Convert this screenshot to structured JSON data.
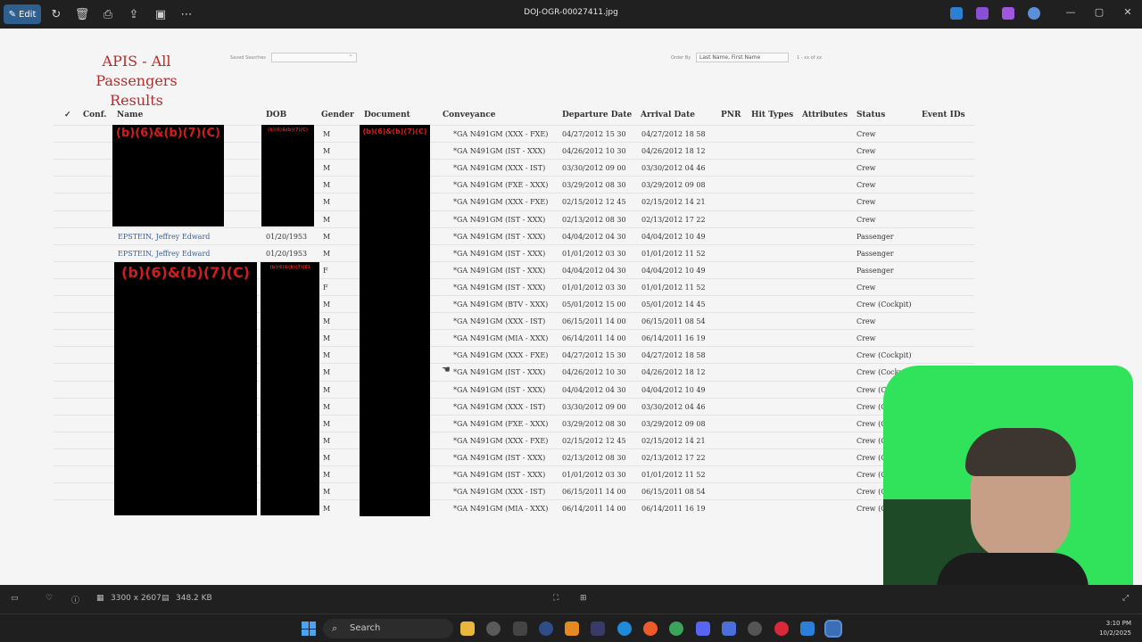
{
  "viewer": {
    "edit_label": "Edit",
    "filename": "DOJ-OGR-00027411.jpg",
    "image_dimensions": "3300 x 2607",
    "file_size": "348.2 KB"
  },
  "document": {
    "title_line1": "APIS - All Passengers",
    "title_line2": "Results",
    "saved_searches_label": "Saved Searches",
    "order_by_label": "Order By",
    "order_by_value": "Last Name, First Name",
    "records_label": "1 - xx of xx"
  },
  "table": {
    "headers": {
      "check": "✓",
      "conf": "Conf.",
      "name": "Name",
      "dob": "DOB",
      "gender": "Gender",
      "document": "Document",
      "conveyance": "Conveyance",
      "departure": "Departure Date",
      "arrival": "Arrival Date",
      "pnr": "PNR",
      "hit_types": "Hit Types",
      "attributes": "Attributes",
      "status": "Status",
      "event_ids": "Event IDs"
    },
    "redaction_label": "(b)(6)&(b)(7)(C)",
    "rows": [
      {
        "name": "",
        "dob": "",
        "gender": "M",
        "conveyance": "*GA N491GM (XXX - FXE)",
        "departure": "04/27/2012 15 30",
        "arrival": "04/27/2012 18 58",
        "status": "Crew"
      },
      {
        "name": "",
        "dob": "",
        "gender": "M",
        "conveyance": "*GA N491GM (IST - XXX)",
        "departure": "04/26/2012 10 30",
        "arrival": "04/26/2012 18 12",
        "status": "Crew"
      },
      {
        "name": "",
        "dob": "",
        "gender": "M",
        "conveyance": "*GA N491GM (XXX - IST)",
        "departure": "03/30/2012 09 00",
        "arrival": "03/30/2012 04 46",
        "status": "Crew"
      },
      {
        "name": "",
        "dob": "",
        "gender": "M",
        "conveyance": "*GA N491GM (FXE - XXX)",
        "departure": "03/29/2012 08 30",
        "arrival": "03/29/2012 09 08",
        "status": "Crew"
      },
      {
        "name": "",
        "dob": "",
        "gender": "M",
        "conveyance": "*GA N491GM (XXX - FXE)",
        "departure": "02/15/2012 12 45",
        "arrival": "02/15/2012 14 21",
        "status": "Crew"
      },
      {
        "name": "",
        "dob": "",
        "gender": "M",
        "conveyance": "*GA N491GM (IST - XXX)",
        "departure": "02/13/2012 08 30",
        "arrival": "02/13/2012 17 22",
        "status": "Crew"
      },
      {
        "name": "EPSTEIN, Jeffrey Edward",
        "dob": "01/20/1953",
        "gender": "M",
        "conveyance": "*GA N491GM (IST - XXX)",
        "departure": "04/04/2012 04 30",
        "arrival": "04/04/2012 10 49",
        "status": "Passenger"
      },
      {
        "name": "EPSTEIN, Jeffrey Edward",
        "dob": "01/20/1953",
        "gender": "M",
        "conveyance": "*GA N491GM (IST - XXX)",
        "departure": "01/01/2012 03 30",
        "arrival": "01/01/2012 11 52",
        "status": "Passenger"
      },
      {
        "name": "",
        "dob": "",
        "gender": "F",
        "conveyance": "*GA N491GM (IST - XXX)",
        "departure": "04/04/2012 04 30",
        "arrival": "04/04/2012 10 49",
        "status": "Passenger"
      },
      {
        "name": "",
        "dob": "",
        "gender": "F",
        "conveyance": "*GA N491GM (IST - XXX)",
        "departure": "01/01/2012 03 30",
        "arrival": "01/01/2012 11 52",
        "status": "Crew"
      },
      {
        "name": "",
        "dob": "",
        "gender": "M",
        "conveyance": "*GA N491GM (BTV - XXX)",
        "departure": "05/01/2012 15 00",
        "arrival": "05/01/2012 14 45",
        "status": "Crew (Cockpit)"
      },
      {
        "name": "",
        "dob": "",
        "gender": "M",
        "conveyance": "*GA N491GM (XXX - IST)",
        "departure": "06/15/2011 14 00",
        "arrival": "06/15/2011 08 54",
        "status": "Crew"
      },
      {
        "name": "",
        "dob": "",
        "gender": "M",
        "conveyance": "*GA N491GM (MIA - XXX)",
        "departure": "06/14/2011 14 00",
        "arrival": "06/14/2011 16 19",
        "status": "Crew"
      },
      {
        "name": "",
        "dob": "",
        "gender": "M",
        "conveyance": "*GA N491GM (XXX - FXE)",
        "departure": "04/27/2012 15 30",
        "arrival": "04/27/2012 18 58",
        "status": "Crew (Cockpit)"
      },
      {
        "name": "",
        "dob": "",
        "gender": "M",
        "conveyance": "*GA N491GM (IST - XXX)",
        "departure": "04/26/2012 10 30",
        "arrival": "04/26/2012 18 12",
        "status": "Crew (Cockpit)"
      },
      {
        "name": "",
        "dob": "",
        "gender": "M",
        "conveyance": "*GA N491GM (IST - XXX)",
        "departure": "04/04/2012 04 30",
        "arrival": "04/04/2012 10 49",
        "status": "Crew (Cockpit)"
      },
      {
        "name": "",
        "dob": "",
        "gender": "M",
        "conveyance": "*GA N491GM (XXX - IST)",
        "departure": "03/30/2012 09 00",
        "arrival": "03/30/2012 04 46",
        "status": "Crew (Cockpit)"
      },
      {
        "name": "",
        "dob": "",
        "gender": "M",
        "conveyance": "*GA N491GM (FXE - XXX)",
        "departure": "03/29/2012 08 30",
        "arrival": "03/29/2012 09 08",
        "status": "Crew (Cockpit)"
      },
      {
        "name": "",
        "dob": "",
        "gender": "M",
        "conveyance": "*GA N491GM (XXX - FXE)",
        "departure": "02/15/2012 12 45",
        "arrival": "02/15/2012 14 21",
        "status": "Crew (Cockpit)"
      },
      {
        "name": "",
        "dob": "",
        "gender": "M",
        "conveyance": "*GA N491GM (IST - XXX)",
        "departure": "02/13/2012 08 30",
        "arrival": "02/13/2012 17 22",
        "status": "Crew (Cockpit)"
      },
      {
        "name": "",
        "dob": "",
        "gender": "M",
        "conveyance": "*GA N491GM (IST - XXX)",
        "departure": "01/01/2012 03 30",
        "arrival": "01/01/2012 11 52",
        "status": "Crew (Cockpit)"
      },
      {
        "name": "",
        "dob": "",
        "gender": "M",
        "conveyance": "*GA N491GM (XXX - IST)",
        "departure": "06/15/2011 14 00",
        "arrival": "06/15/2011 08 54",
        "status": "Crew (Cockpit)"
      },
      {
        "name": "",
        "dob": "",
        "gender": "M",
        "conveyance": "*GA N491GM (MIA - XXX)",
        "departure": "06/14/2011 14 00",
        "arrival": "06/14/2011 16 19",
        "status": "Crew (Cockpit)"
      }
    ]
  },
  "taskbar": {
    "search_placeholder": "Search",
    "time": "3:10 PM",
    "date": "10/2/2025"
  },
  "colors": {
    "title_red": "#b52c2c",
    "link_blue": "#3a5f9a",
    "webcam_green": "#30e35a"
  }
}
